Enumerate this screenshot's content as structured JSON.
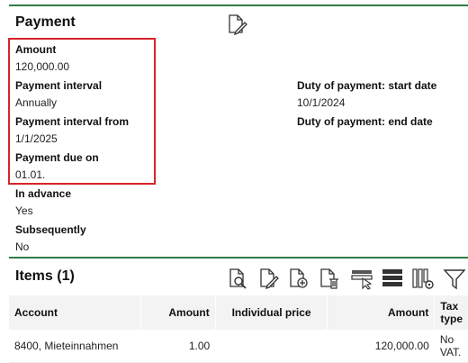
{
  "payment": {
    "title": "Payment",
    "fields": {
      "amount_label": "Amount",
      "amount_value": "120,000.00",
      "interval_label": "Payment interval",
      "interval_value": "Annually",
      "interval_from_label": "Payment interval from",
      "interval_from_value": "1/1/2025",
      "due_on_label": "Payment due on",
      "due_on_value": "01.01.",
      "in_advance_label": "In advance",
      "in_advance_value": "Yes",
      "subsequently_label": "Subsequently",
      "subsequently_value": "No",
      "duty_start_label": "Duty of payment: start date",
      "duty_start_value": "10/1/2024",
      "duty_end_label": "Duty of payment: end date"
    },
    "highlight_color": "#d8232a",
    "section_line_color": "#2e7d46"
  },
  "items": {
    "title": "Items (1)",
    "toolbar_icons": [
      "view-document-icon",
      "edit-document-icon",
      "add-document-icon",
      "delete-document-icon",
      "select-row-icon",
      "list-view-icon",
      "column-settings-icon",
      "filter-icon"
    ],
    "columns": [
      "Account",
      "Amount",
      "Individual price",
      "Amount",
      "Tax type"
    ],
    "rows": [
      [
        "8400, Mieteinnahmen",
        "1.00",
        "",
        "120,000.00",
        "No VAT."
      ]
    ]
  }
}
